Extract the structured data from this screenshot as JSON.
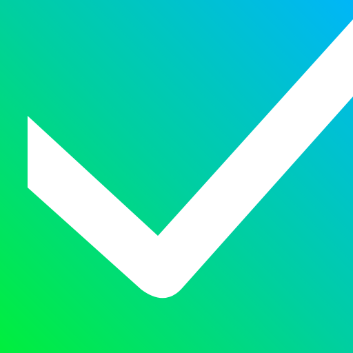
{
  "icon": {
    "name": "checkmark-icon",
    "background_gradient": {
      "start_color": "#00ef3c",
      "mid_color": "#00cfa0",
      "end_color": "#00b6f8"
    },
    "mark_color": "#ffffff"
  }
}
